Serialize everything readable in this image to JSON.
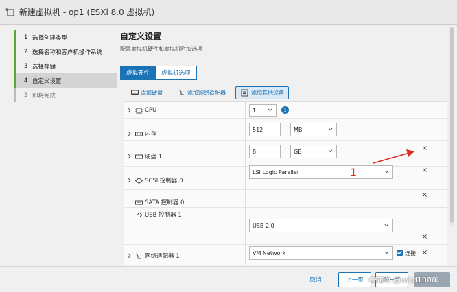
{
  "window": {
    "title": "新建虚拟机 - op1 (ESXi 8.0 虚拟机)"
  },
  "steps": [
    {
      "num": "1",
      "label": "选择创建类型"
    },
    {
      "num": "2",
      "label": "选择名称和客户机操作系统"
    },
    {
      "num": "3",
      "label": "选择存储"
    },
    {
      "num": "4",
      "label": "自定义设置"
    },
    {
      "num": "5",
      "label": "即将完成"
    }
  ],
  "main": {
    "title": "自定义设置",
    "subtitle": "配置虚拟机硬件和虚拟机附加选项"
  },
  "tabs": {
    "hardware": "虚拟硬件",
    "options": "虚拟机选项"
  },
  "actions": {
    "add_disk": "添加硬盘",
    "add_nic": "添加网络适配器",
    "add_other": "添加其他设备"
  },
  "rows": {
    "cpu": {
      "label": "CPU",
      "value": "1"
    },
    "memory": {
      "label": "内存",
      "value": "512",
      "unit": "MB"
    },
    "disk": {
      "label": "硬盘 1",
      "value": "8",
      "unit": "GB"
    },
    "scsi": {
      "label": "SCSI 控制器 0",
      "value": "LSI Logic Parallel"
    },
    "sata": {
      "label": "SATA 控制器 0"
    },
    "usb": {
      "label": "USB 控制器 1",
      "value": "USB 2.0"
    },
    "net": {
      "label": "网络适配器 1",
      "value": "VM Network",
      "connect": "连接"
    }
  },
  "close_symbol": "×",
  "info_symbol": "i",
  "annotation": {
    "text": "1",
    "color": "#e02b20"
  },
  "footer": {
    "cancel": "取消",
    "prev": "上一页",
    "next": "下一页",
    "finish": "完成"
  },
  "watermark": "CSDN @mkd1000",
  "colors": {
    "accent": "#1a73b5",
    "step_done": "#5aa637"
  }
}
